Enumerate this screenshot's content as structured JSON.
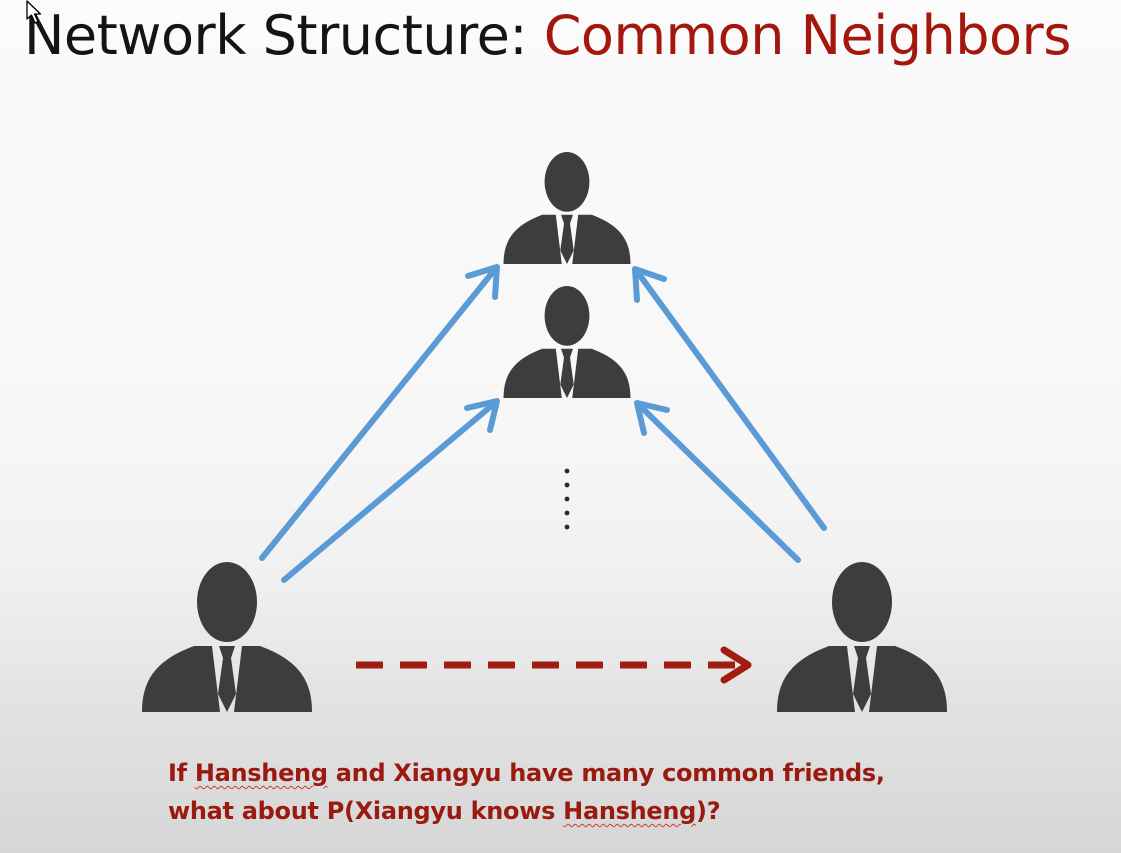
{
  "title": {
    "prefix": "Network Structure: ",
    "accent": "Common Neighbors"
  },
  "caption": {
    "line1": {
      "part1": "If ",
      "name1": "Hansheng",
      "part2": " and Xiangyu have many common friends,"
    },
    "line2": {
      "part1": "what about P(Xiangyu knows ",
      "name2": "Hansheng",
      "part2": ")?"
    }
  },
  "colors": {
    "person": "#3d3d3d",
    "edge_arrow": "#5b9bd5",
    "predicted_link": "#a01d10",
    "title_accent": "#a3170c",
    "caption": "#9a1a10"
  },
  "icons": {
    "person": "person-icon",
    "ellipsis": "vertical-ellipsis-icon",
    "cursor": "mouse-cursor-icon"
  }
}
